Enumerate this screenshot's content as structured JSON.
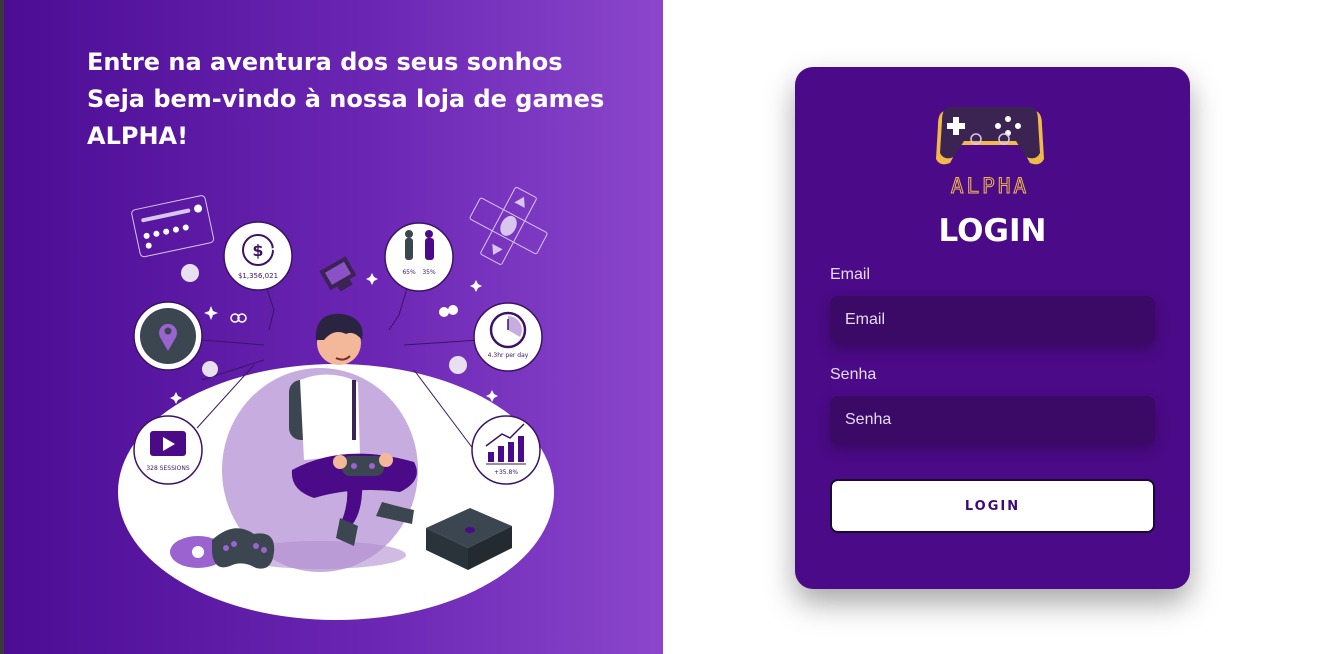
{
  "hero": {
    "line1": "Entre na aventura dos seus sonhos",
    "line2": "Seja bem-vindo à nossa loja de games",
    "line3": "ALPHA!",
    "illustration": {
      "money": "$1,356,021",
      "pct_male": "65%",
      "pct_female": "35%",
      "time": "4.3hr per day",
      "sessions": "328 SESSIONS",
      "growth": "+35.8%"
    }
  },
  "card": {
    "logo_text": "ALPHA",
    "title": "LOGIN",
    "email_label": "Email",
    "email_placeholder": "Email",
    "password_label": "Senha",
    "password_placeholder": "Senha",
    "button_label": "LOGIN"
  },
  "colors": {
    "accent": "#4b0a87",
    "hero_start": "#4c0c93",
    "hero_end": "#8b46cc",
    "logo_gold": "#f0b94a"
  }
}
